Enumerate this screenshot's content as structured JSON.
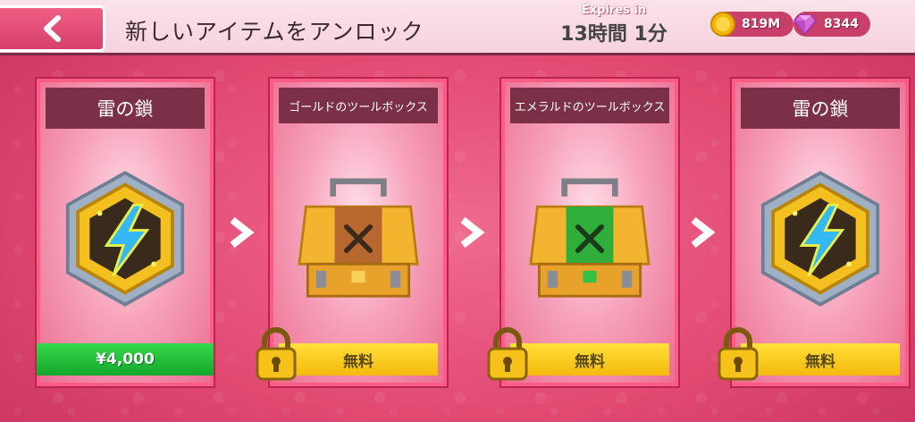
{
  "header": {
    "title": "新しいアイテムをアンロック",
    "expires_label": "Expires in",
    "expires_time": "13時間 1分"
  },
  "currency": {
    "coins": "819M",
    "gems": "8344"
  },
  "cards": [
    {
      "title": "雷の鎖",
      "icon": "lightning-badge",
      "price": "¥4,000",
      "locked": false
    },
    {
      "title": "ゴールドのツールボックス",
      "icon": "gold-toolbox",
      "price": "無料",
      "locked": true
    },
    {
      "title": "エメラルドのツールボックス",
      "icon": "emerald-toolbox",
      "price": "無料",
      "locked": true
    },
    {
      "title": "雷の鎖",
      "icon": "lightning-badge",
      "price": "無料",
      "locked": true
    }
  ],
  "colors": {
    "background": "#e24a72",
    "header_bg": "#7b3048",
    "buy_green": "#14a82b",
    "free_yellow": "#f5b90c"
  }
}
